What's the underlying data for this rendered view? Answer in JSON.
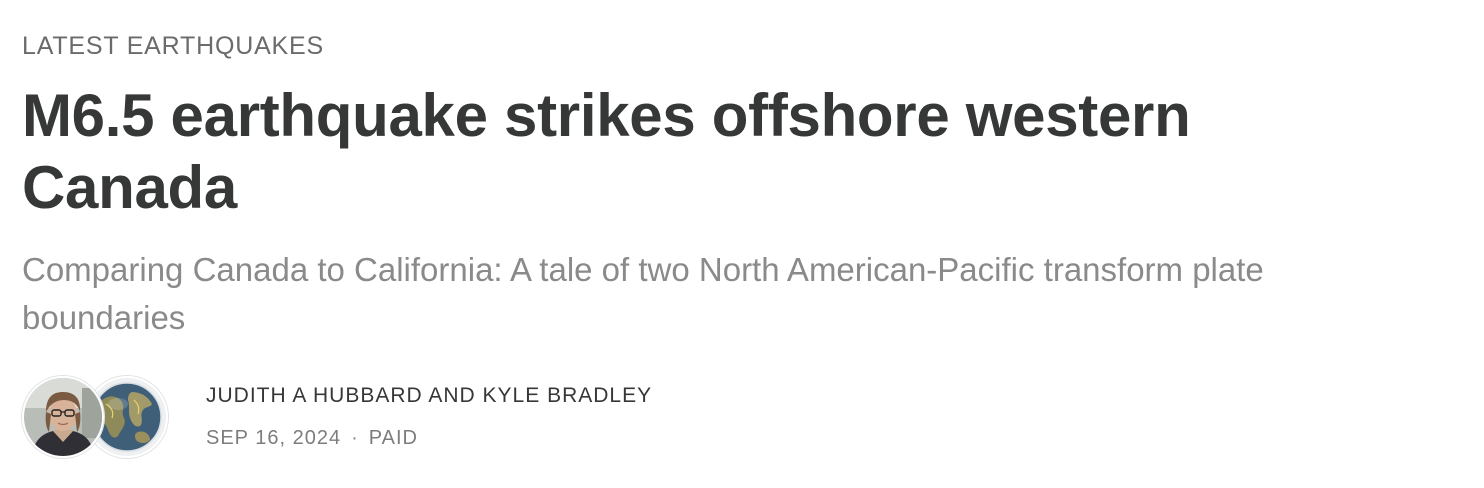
{
  "post": {
    "section": "LATEST EARTHQUAKES",
    "title": "M6.5 earthquake strikes offshore western Canada",
    "subtitle": "Comparing Canada to California: A tale of two North American-Pacific transform plate boundaries",
    "authors": "JUDITH A HUBBARD AND KYLE BRADLEY",
    "date": "SEP 16, 2024",
    "separator": "·",
    "access": "PAID"
  },
  "avatars": [
    {
      "icon": "author-photo-avatar"
    },
    {
      "icon": "globe-avatar"
    }
  ],
  "colors": {
    "text": "#363737",
    "muted": "#8a8a8a",
    "label": "#6b6b6b"
  }
}
